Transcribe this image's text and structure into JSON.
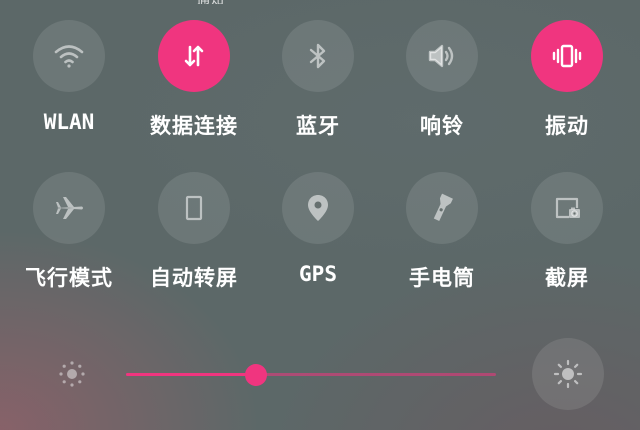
{
  "status_fragment": "通知",
  "tiles": [
    {
      "label": "WLAN",
      "icon": "wifi-icon",
      "active": false
    },
    {
      "label": "数据连接",
      "icon": "data-transfer-icon",
      "active": true
    },
    {
      "label": "蓝牙",
      "icon": "bluetooth-icon",
      "active": false
    },
    {
      "label": "响铃",
      "icon": "speaker-icon",
      "active": false
    },
    {
      "label": "振动",
      "icon": "vibrate-icon",
      "active": true
    },
    {
      "label": "飞行模式",
      "icon": "airplane-icon",
      "active": false
    },
    {
      "label": "自动转屏",
      "icon": "screen-rotate-icon",
      "active": false
    },
    {
      "label": "GPS",
      "icon": "location-pin-icon",
      "active": false
    },
    {
      "label": "手电筒",
      "icon": "flashlight-icon",
      "active": false
    },
    {
      "label": "截屏",
      "icon": "screenshot-icon",
      "active": false
    }
  ],
  "brightness": {
    "level": 0.35
  },
  "colors": {
    "accent": "#f0357f",
    "text": "#ffffff"
  }
}
